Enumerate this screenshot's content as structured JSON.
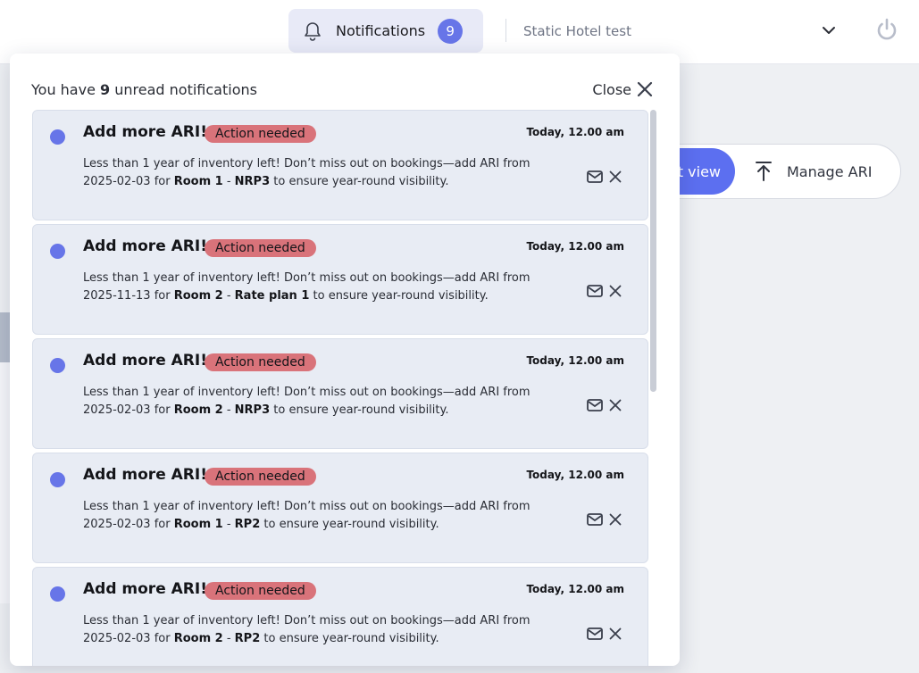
{
  "topbar": {
    "notifications_label": "Notifications",
    "notifications_count": "9",
    "hotel_name": "Static Hotel test"
  },
  "background": {
    "view_button_label": "t view",
    "manage_label": "Manage ARI"
  },
  "panel": {
    "unread_prefix": "You have ",
    "unread_count": "9",
    "unread_suffix": " unread notifications",
    "close_label": "Close"
  },
  "notifications": [
    {
      "title": "Add more ARI!",
      "badge": "Action needed",
      "time": "Today, 12.00 am",
      "text_1": "Less than 1 year of inventory left! Don’t miss out on bookings—add ARI from",
      "date": "2025-02-03",
      "room": "Room 1",
      "rate": "NRP3"
    },
    {
      "title": "Add more ARI!",
      "badge": "Action needed",
      "time": "Today, 12.00 am",
      "text_1": "Less than 1 year of inventory left! Don’t miss out on bookings—add ARI from",
      "date": "2025-11-13",
      "room": "Room 2",
      "rate": "Rate plan 1"
    },
    {
      "title": "Add more ARI!",
      "badge": "Action needed",
      "time": "Today, 12.00 am",
      "text_1": "Less than 1 year of inventory left! Don’t miss out on bookings—add ARI from",
      "date": "2025-02-03",
      "room": "Room 2",
      "rate": "NRP3"
    },
    {
      "title": "Add more ARI!",
      "badge": "Action needed",
      "time": "Today, 12.00 am",
      "text_1": "Less than 1 year of inventory left! Don’t miss out on bookings—add ARI from",
      "date": "2025-02-03",
      "room": "Room 1",
      "rate": "RP2"
    },
    {
      "title": "Add more ARI!",
      "badge": "Action needed",
      "time": "Today, 12.00 am",
      "text_1": "Less than 1 year of inventory left! Don’t miss out on bookings—add ARI from",
      "date": "2025-02-03",
      "room": "Room 2",
      "rate": "RP2"
    }
  ],
  "text": {
    "for": " for ",
    "dash": " - ",
    "tail": " to ensure year-round visibility."
  },
  "colors": {
    "accent": "#6775e8",
    "badge": "#d9737a",
    "card_bg": "#e8ecf4"
  }
}
